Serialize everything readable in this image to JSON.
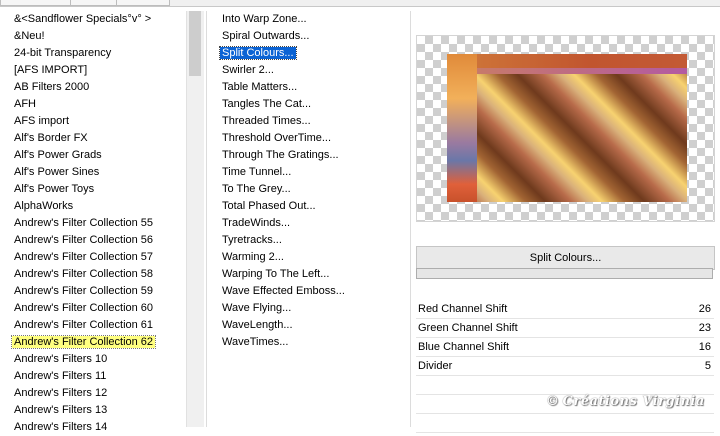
{
  "filters_list": {
    "items": [
      "&<Sandflower Specials°v° >",
      "&Neu!",
      "24-bit Transparency",
      "[AFS IMPORT]",
      "AB Filters 2000",
      "AFH",
      "AFS import",
      "Alf's Border FX",
      "Alf's Power Grads",
      "Alf's Power Sines",
      "Alf's Power Toys",
      "AlphaWorks",
      "Andrew's Filter Collection 55",
      "Andrew's Filter Collection 56",
      "Andrew's Filter Collection 57",
      "Andrew's Filter Collection 58",
      "Andrew's Filter Collection 59",
      "Andrew's Filter Collection 60",
      "Andrew's Filter Collection 61",
      "Andrew's Filter Collection 62",
      "Andrew's Filters 10",
      "Andrew's Filters 11",
      "Andrew's Filters 12",
      "Andrew's Filters 13",
      "Andrew's Filters 14"
    ],
    "selected": "Andrew's Filter Collection 62"
  },
  "effects_list": {
    "items": [
      "Into Warp Zone...",
      "Spiral Outwards...",
      "Split Colours...",
      "Swirler 2...",
      "Table Matters...",
      "Tangles The Cat...",
      "Threaded Times...",
      "Threshold OverTime...",
      "Through The Gratings...",
      "Time Tunnel...",
      "To The Grey...",
      "Total Phased Out...",
      "TradeWinds...",
      "Tyretracks...",
      "Warming 2...",
      "Warping To The Left...",
      "Wave Effected Emboss...",
      "Wave Flying...",
      "WaveLength...",
      "WaveTimes..."
    ],
    "selected": "Split Colours..."
  },
  "effect_button_label": "Split Colours...",
  "progress_fraction": 0,
  "parameters": [
    {
      "name": "Red Channel Shift",
      "value": "26"
    },
    {
      "name": "Green Channel Shift",
      "value": "23"
    },
    {
      "name": "Blue Channel Shift",
      "value": "16"
    },
    {
      "name": "Divider",
      "value": "5"
    }
  ],
  "watermark": {
    "symbol": "©",
    "text": "Créations Virginia"
  },
  "colors": {
    "selection_yellow": "#ffff80",
    "selection_blue": "#0b63d4",
    "progress_green": "#06b025"
  }
}
